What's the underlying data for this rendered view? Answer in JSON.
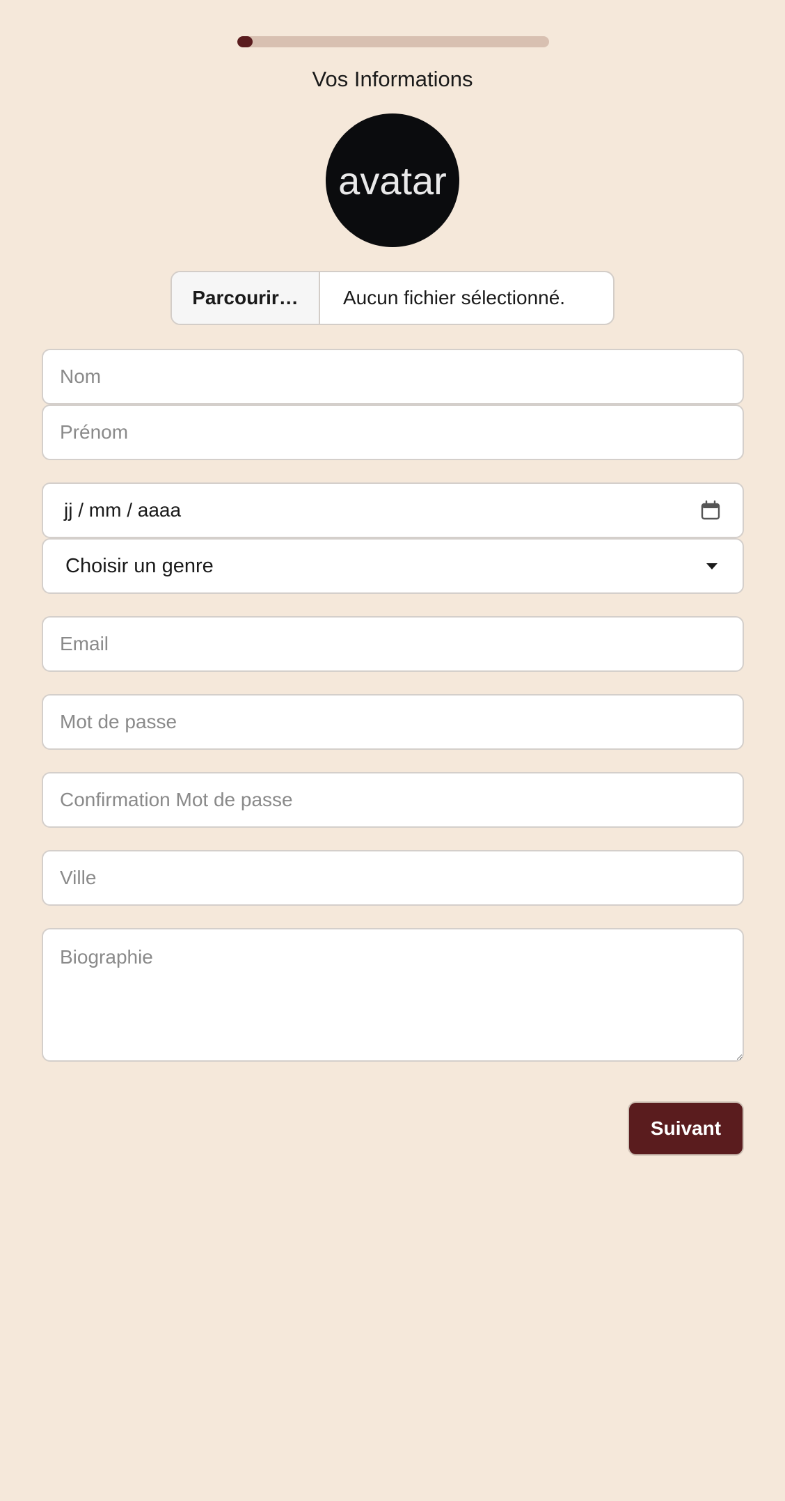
{
  "progress": {
    "value": 0.05,
    "fill_color": "#5a1c1e",
    "track_color": "#d8c0b1"
  },
  "header": {
    "title": "Vos Informations"
  },
  "avatar": {
    "label": "avatar"
  },
  "file_upload": {
    "browse_label": "Parcourir…",
    "status": "Aucun fichier sélectionné."
  },
  "form": {
    "nom_placeholder": "Nom",
    "prenom_placeholder": "Prénom",
    "date_placeholder": "jj / mm / aaaa",
    "genre_selected": "Choisir un genre",
    "email_placeholder": "Email",
    "password_placeholder": "Mot de passe",
    "password_confirm_placeholder": "Confirmation Mot de passe",
    "ville_placeholder": "Ville",
    "bio_placeholder": "Biographie"
  },
  "actions": {
    "next_label": "Suivant"
  },
  "colors": {
    "background": "#f5e8da",
    "accent": "#5a1c1e"
  },
  "icons": {
    "date": "calendar-icon",
    "select": "chevron-down-icon"
  }
}
